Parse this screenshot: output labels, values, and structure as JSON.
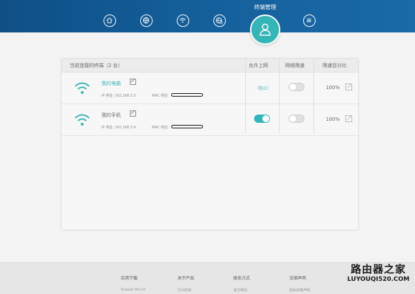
{
  "header": {
    "title": "终端管理",
    "nav": [
      "home-icon",
      "globe-icon",
      "wifi-icon",
      "globe-settings-icon",
      "user-icon",
      "menu-icon"
    ]
  },
  "table": {
    "col_device": "当前连接的终端（2 台）",
    "col_allow": "允许上网",
    "col_limit": "网络限速",
    "col_percent": "限速百分比",
    "rows": [
      {
        "name": "我的电脑",
        "ip": "IP 地址: 192.168.3.3",
        "mac_label": "MAC 地址:",
        "allow_status": "（阻止）",
        "allow_on": false,
        "limit_on": false,
        "percent": "100%"
      },
      {
        "name": "我的手机",
        "ip": "IP 地址: 192.168.3.4",
        "mac_label": "MAC 地址:",
        "allow_status": "",
        "allow_on": true,
        "limit_on": false,
        "percent": "100%"
      }
    ]
  },
  "footer": {
    "col1": {
      "title": "应用下载",
      "item": "Huawei HiLink"
    },
    "col2": {
      "title": "关于产品",
      "item": "华为商城"
    },
    "col3": {
      "title": "联系方式",
      "item": "官方微信"
    },
    "col4": {
      "title": "法律声明",
      "item": "隐私政策声明"
    }
  },
  "watermark": {
    "main": "路由器之家",
    "sub": "LUYOUQI520.COM"
  },
  "colors": {
    "header": "#14609c",
    "accent": "#35b5b8"
  }
}
